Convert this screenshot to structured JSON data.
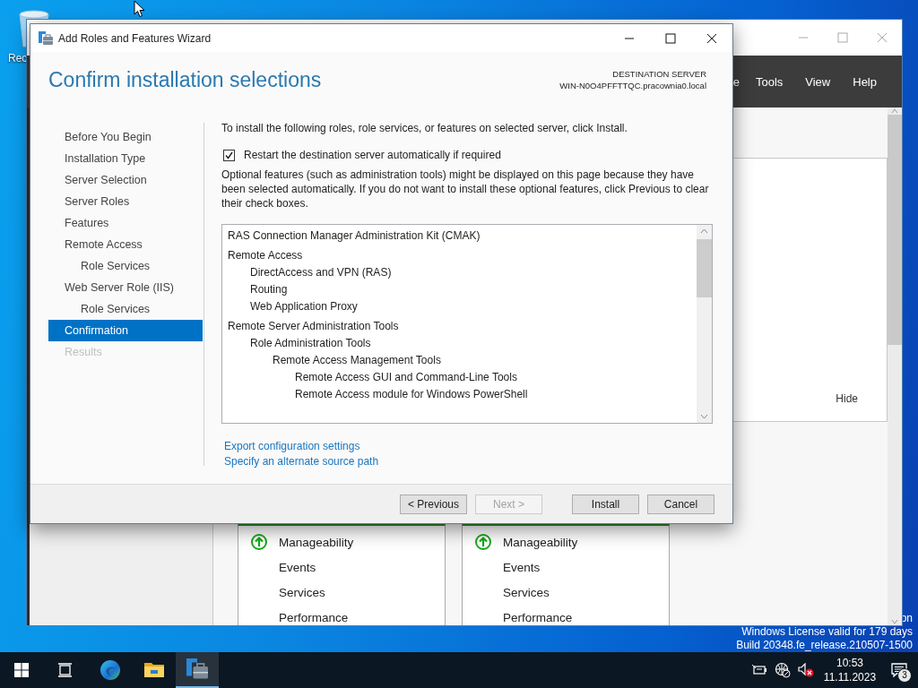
{
  "desktop": {
    "recycle_bin_label": "Rec",
    "info_lines": [
      "on",
      "Windows License valid for 179 days",
      "Build 20348.fe_release.210507-1500"
    ]
  },
  "server_manager": {
    "menu": [
      "e",
      "Tools",
      "View",
      "Help"
    ],
    "hide_link": "Hide",
    "tiles": [
      {
        "items": [
          {
            "label": "Manageability",
            "ok": true
          },
          {
            "label": "Events",
            "ok": false
          },
          {
            "label": "Services",
            "ok": false
          },
          {
            "label": "Performance",
            "ok": false
          }
        ]
      },
      {
        "items": [
          {
            "label": "Manageability",
            "ok": true
          },
          {
            "label": "Events",
            "ok": false
          },
          {
            "label": "Services",
            "ok": false
          },
          {
            "label": "Performance",
            "ok": false
          }
        ]
      }
    ]
  },
  "wizard": {
    "title": "Add Roles and Features Wizard",
    "heading": "Confirm installation selections",
    "destination_label": "DESTINATION SERVER",
    "destination_server": "WIN-N0O4PFFTTQC.pracownia0.local",
    "steps": [
      {
        "label": "Before You Begin",
        "selected": false,
        "disabled": false
      },
      {
        "label": "Installation Type",
        "selected": false,
        "disabled": false
      },
      {
        "label": "Server Selection",
        "selected": false,
        "disabled": false
      },
      {
        "label": "Server Roles",
        "selected": false,
        "disabled": false
      },
      {
        "label": "Features",
        "selected": false,
        "disabled": false
      },
      {
        "label": "Remote Access",
        "selected": false,
        "disabled": false,
        "children": [
          {
            "label": "Role Services",
            "selected": false,
            "disabled": false
          }
        ]
      },
      {
        "label": "Web Server Role (IIS)",
        "selected": false,
        "disabled": false,
        "children": [
          {
            "label": "Role Services",
            "selected": false,
            "disabled": false
          }
        ]
      },
      {
        "label": "Confirmation",
        "selected": true,
        "disabled": false
      },
      {
        "label": "Results",
        "selected": false,
        "disabled": true
      }
    ],
    "intro": "To install the following roles, role services, or features on selected server, click Install.",
    "restart_option": {
      "label": "Restart the destination server automatically if required",
      "checked": true
    },
    "note": "Optional features (such as administration tools) might be displayed on this page because they have been selected automatically. If you do not want to install these optional features, click Previous to clear their check boxes.",
    "selections": [
      {
        "label": "RAS Connection Manager Administration Kit (CMAK)"
      },
      {
        "label": "Remote Access",
        "children": [
          {
            "label": "DirectAccess and VPN (RAS)"
          },
          {
            "label": "Routing"
          },
          {
            "label": "Web Application Proxy"
          }
        ]
      },
      {
        "label": "Remote Server Administration Tools",
        "children": [
          {
            "label": "Role Administration Tools",
            "children": [
              {
                "label": "Remote Access Management Tools",
                "children": [
                  {
                    "label": "Remote Access GUI and Command-Line Tools"
                  },
                  {
                    "label": "Remote Access module for Windows PowerShell"
                  }
                ]
              }
            ]
          }
        ]
      }
    ],
    "links": [
      "Export configuration settings",
      "Specify an alternate source path"
    ],
    "buttons": [
      {
        "label": "< Previous",
        "disabled": false
      },
      {
        "label": "Next >",
        "disabled": true
      },
      {
        "label": "Install",
        "disabled": false
      },
      {
        "label": "Cancel",
        "disabled": false
      }
    ]
  },
  "taskbar": {
    "apps": [
      {
        "kind": "start",
        "active": false
      },
      {
        "kind": "task-view",
        "active": false
      },
      {
        "kind": "browser",
        "active": false
      },
      {
        "kind": "folder",
        "active": false
      },
      {
        "kind": "server-manager",
        "active": true
      }
    ],
    "time": "10:53",
    "date": "11.11.2023",
    "notification_count": "3"
  }
}
